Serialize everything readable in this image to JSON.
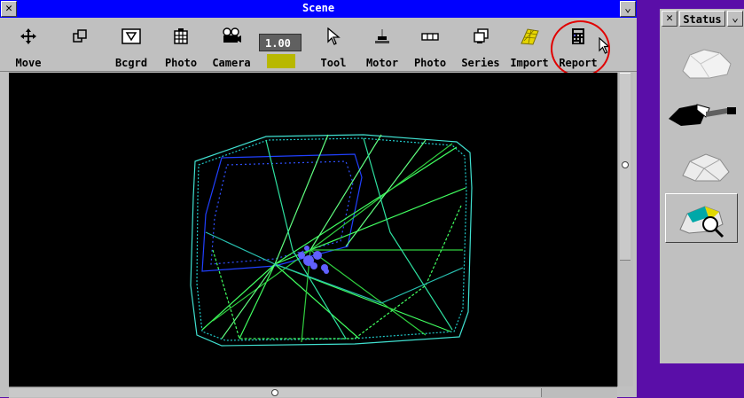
{
  "window": {
    "title": "Scene",
    "close_glyph": "✕",
    "menu_glyph": "⌄"
  },
  "toolbar": {
    "tools": [
      {
        "id": "move",
        "label": "Move",
        "icon": "move-arrows-icon"
      },
      {
        "id": "view",
        "label": "",
        "icon": "overlap-squares-icon"
      },
      {
        "id": "bcgrd",
        "label": "Bcgrd",
        "icon": "background-frame-icon"
      },
      {
        "id": "photo",
        "label": "Photo",
        "icon": "photo-grid-icon"
      },
      {
        "id": "camera",
        "label": "Camera",
        "icon": "camera-icon"
      },
      {
        "id": "tool",
        "label": "Tool",
        "icon": "cursor-arrow-icon"
      },
      {
        "id": "motor",
        "label": "Motor",
        "icon": "motor-icon"
      },
      {
        "id": "photo2",
        "label": "Photo",
        "icon": "photo-strip-icon"
      },
      {
        "id": "series",
        "label": "Series",
        "icon": "series-frames-icon"
      },
      {
        "id": "import",
        "label": "Import",
        "icon": "import-mesh-icon"
      },
      {
        "id": "report",
        "label": "Report",
        "icon": "report-icon"
      }
    ],
    "zoom_value": "1.00",
    "zoom_swatch_color": "#b8b800",
    "highlight_color": "#e00000"
  },
  "status_panel": {
    "title": "Status",
    "close_glyph": "✕",
    "menu_glyph": "⌄",
    "thumbnails": [
      {
        "id": "gem-white",
        "icon": "white-rock-icon",
        "selected": false
      },
      {
        "id": "gem-dark-probe",
        "icon": "dark-rock-probe-icon",
        "selected": false
      },
      {
        "id": "gem-faceted",
        "icon": "faceted-rock-icon",
        "selected": false
      },
      {
        "id": "gem-inspect",
        "icon": "colored-rock-magnifier-icon",
        "selected": true
      }
    ]
  },
  "colors": {
    "desktop": "#5a0ea8",
    "titlebar": "#0000ff",
    "viewport": "#000000"
  }
}
